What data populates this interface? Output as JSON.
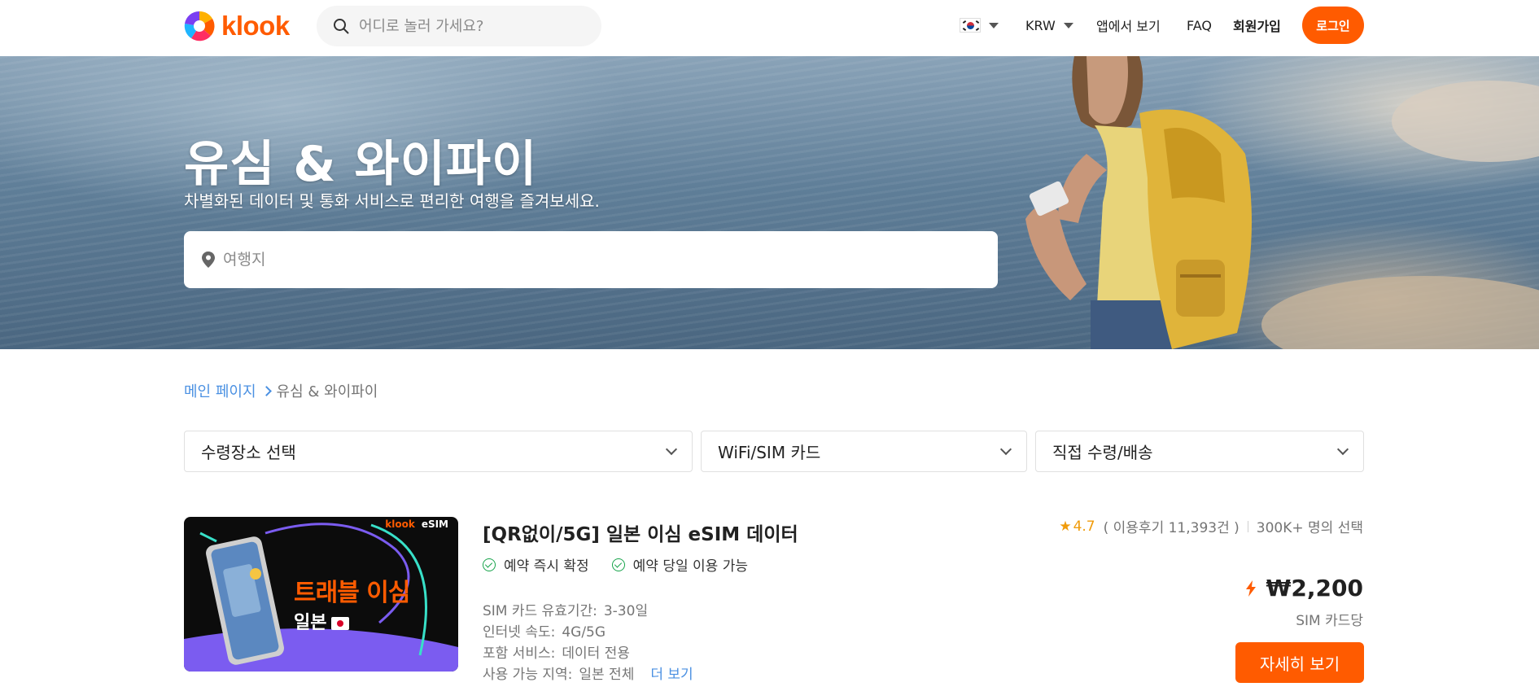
{
  "header": {
    "logo_text": "klook",
    "search_placeholder": "어디로 놀러 가세요?",
    "currency": "KRW",
    "app_label": "앱에서 보기",
    "faq_label": "FAQ",
    "signup_label": "회원가입",
    "login_label": "로그인"
  },
  "hero": {
    "title": "유심 & 와이파이",
    "subtitle": "차별화된 데이터 및 통화 서비스로 편리한 여행을 즐겨보세요.",
    "destination_placeholder": "여행지"
  },
  "breadcrumb": {
    "home": "메인 페이지",
    "current": "유심 & 와이파이"
  },
  "filters": {
    "pickup": "수령장소 선택",
    "type": "WiFi/SIM 카드",
    "delivery": "직접 수령/배송"
  },
  "product": {
    "thumb_brand": "klook",
    "thumb_brand_tag": "eSIM",
    "thumb_title": "트래블 이심",
    "thumb_subtitle": "일본",
    "title": "[QR없이/5G] 일본 이심 eSIM 데이터",
    "badges": [
      "예약 즉시 확정",
      "예약 당일 이용 가능"
    ],
    "specs": [
      {
        "label": "SIM 카드 유효기간:",
        "value": "3-30일"
      },
      {
        "label": "인터넷 속도:",
        "value": "4G/5G"
      },
      {
        "label": "포함 서비스:",
        "value": "데이터 전용"
      },
      {
        "label": "사용 가능 지역:",
        "value": "일본 전체"
      }
    ],
    "more_label": "더 보기",
    "rating_score": "4.7",
    "review_text": "( 이용후기 11,393건 )",
    "booked_text": "300K+ 명의 선택",
    "price": "₩2,200",
    "price_unit": "SIM 카드당",
    "detail_label": "자세히 보기"
  },
  "colors": {
    "brand": "#ff5b00",
    "link": "#4a90e2",
    "check": "#16a34a",
    "star": "#f09b0a"
  }
}
